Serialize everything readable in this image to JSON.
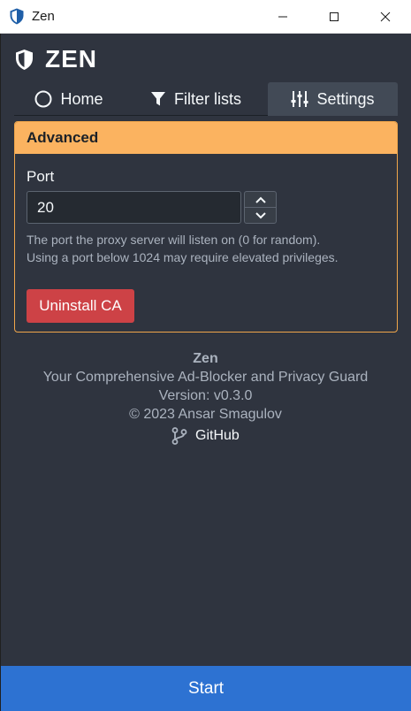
{
  "window": {
    "title": "Zen"
  },
  "app": {
    "brand": "ZEN"
  },
  "tabs": [
    {
      "label": "Home"
    },
    {
      "label": "Filter lists"
    },
    {
      "label": "Settings"
    }
  ],
  "advanced": {
    "header": "Advanced",
    "port_label": "Port",
    "port_value": "20",
    "help_line1": "The port the proxy server will listen on (0 for random).",
    "help_line2": "Using a port below 1024 may require elevated privileges.",
    "uninstall_label": "Uninstall CA"
  },
  "info": {
    "name": "Zen",
    "tagline": "Your Comprehensive Ad-Blocker and Privacy Guard",
    "version": "Version: v0.3.0",
    "copyright": "© 2023 Ansar Smagulov",
    "github": "GitHub"
  },
  "start_label": "Start",
  "colors": {
    "background": "#2f343f",
    "accent_orange": "#fbb360",
    "danger": "#cd4246",
    "primary": "#2d72d2",
    "active_tab": "#424a56"
  }
}
